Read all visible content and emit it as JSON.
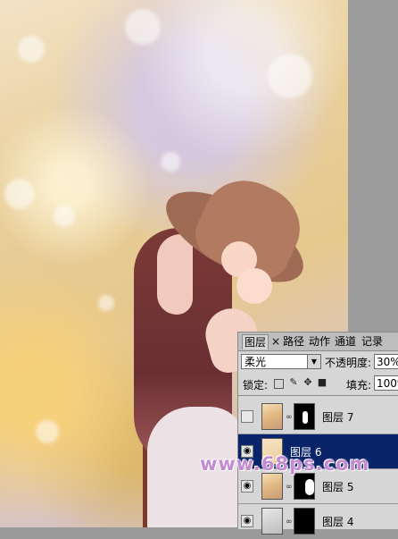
{
  "layers_panel": {
    "tabs": [
      {
        "label": "图层"
      },
      {
        "label": "×"
      },
      {
        "label": "路径"
      },
      {
        "label": "动作"
      },
      {
        "label": "通道"
      },
      {
        "label": "记录"
      }
    ],
    "blend_mode": "柔光",
    "opacity_label": "不透明度:",
    "opacity_value": "30%",
    "lock_label": "锁定:",
    "fill_label": "填充:",
    "fill_value": "100%",
    "layers": [
      {
        "name": "图层 7",
        "visible": false,
        "selected": false
      },
      {
        "name": "图层 6",
        "visible": true,
        "selected": true
      },
      {
        "name": "图层 5",
        "visible": true,
        "selected": false
      },
      {
        "name": "图层 4",
        "visible": true,
        "selected": false
      }
    ]
  },
  "watermark": "www.68ps.com",
  "colors": {
    "selection": "#0a246a",
    "panel": "#d6d6d6",
    "watermark": "#c48bd0"
  }
}
